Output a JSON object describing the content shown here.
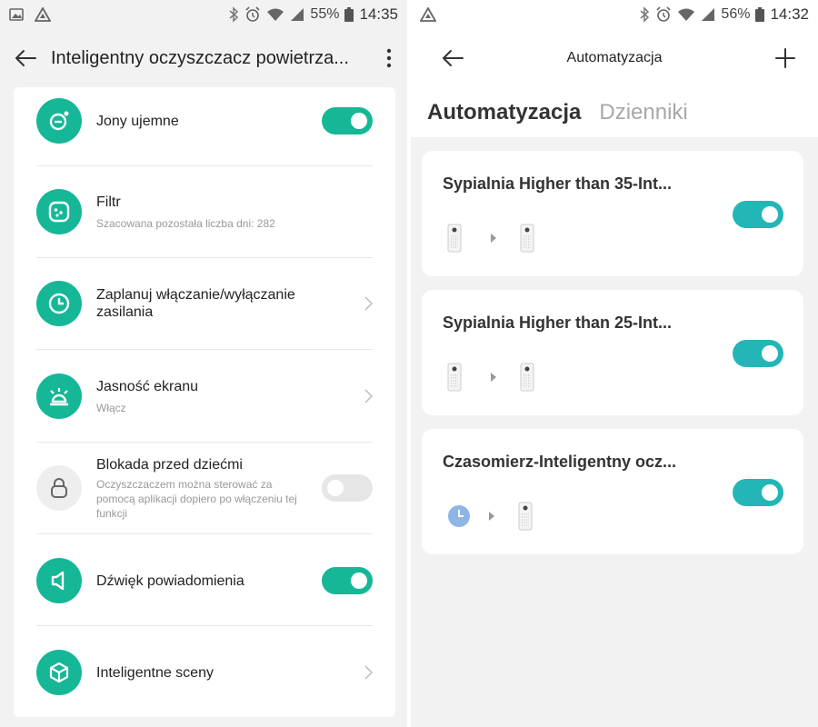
{
  "left": {
    "status": {
      "battery": "55%",
      "time": "14:35"
    },
    "header": {
      "title": "Inteligentny oczyszczacz powietrza..."
    },
    "settings": [
      {
        "title": "Jony ujemne",
        "subtitle": "",
        "control": "toggle",
        "on": true,
        "icon": "negative-ions-icon"
      },
      {
        "title": "Filtr",
        "subtitle": "Szacowana pozostała liczba dni: 282",
        "control": "none",
        "icon": "filter-icon"
      },
      {
        "title": "Zaplanuj włączanie/wyłączanie zasilania",
        "subtitle": "",
        "control": "chevron",
        "icon": "clock-icon"
      },
      {
        "title": "Jasność ekranu",
        "subtitle": "Włącz",
        "control": "chevron",
        "icon": "brightness-icon"
      },
      {
        "title": "Blokada przed dziećmi",
        "subtitle": "Oczyszczaczem można sterować za pomocą aplikacji dopiero po włączeniu tej funkcji",
        "control": "toggle",
        "on": false,
        "icon": "lock-icon"
      },
      {
        "title": "Dźwięk powiadomienia",
        "subtitle": "",
        "control": "toggle",
        "on": true,
        "icon": "speaker-icon"
      },
      {
        "title": "Inteligentne sceny",
        "subtitle": "",
        "control": "chevron",
        "icon": "cube-icon"
      }
    ]
  },
  "right": {
    "status": {
      "battery": "56%",
      "time": "14:32"
    },
    "header": {
      "title": "Automatyzacja"
    },
    "tabs": [
      {
        "label": "Automatyzacja",
        "active": true
      },
      {
        "label": "Dzienniki",
        "active": false
      }
    ],
    "automations": [
      {
        "title": "Sypialnia Higher than 35-Int...",
        "trigger": "device",
        "on": true
      },
      {
        "title": "Sypialnia Higher than 25-Int...",
        "trigger": "device",
        "on": true
      },
      {
        "title": "Czasomierz-Inteligentny ocz...",
        "trigger": "timer",
        "on": true
      }
    ]
  },
  "colors": {
    "accent_left": "#15b797",
    "accent_right": "#24b6b6",
    "background": "#f2f2f2"
  }
}
